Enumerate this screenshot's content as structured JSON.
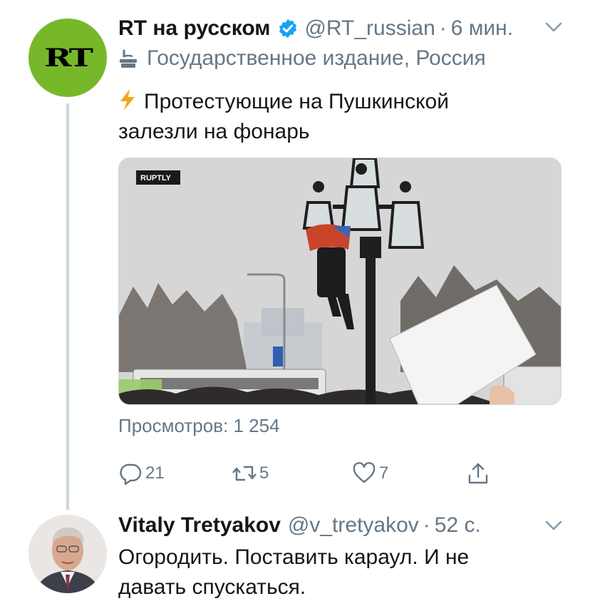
{
  "tweet1": {
    "avatar_text": "RT",
    "name": "RT на русском",
    "handle": "@RT_russian",
    "separator": "·",
    "time": "6 мин.",
    "affiliation": "Государственное издание, Россия",
    "text_line1": "Протестующие на Пушкинской",
    "text_line2": "залезли на фонарь",
    "media_watermark": "RUPTLY",
    "views": "Просмотров: 1 254",
    "actions": {
      "replies": "21",
      "retweets": "5",
      "likes": "7"
    },
    "icons": [
      "verified-badge-icon",
      "chevron-down-icon",
      "state-media-icon",
      "lightning-icon",
      "reply-icon",
      "retweet-icon",
      "like-icon",
      "share-icon"
    ]
  },
  "tweet2": {
    "name": "Vitaly Tretyakov",
    "handle": "@v_tretyakov",
    "separator": "·",
    "time": "52 с.",
    "text_line1": "Огородить. Поставить караул. И не",
    "text_line2": "давать спускаться."
  },
  "colors": {
    "accent": "#1da1f2",
    "secondary_text": "#657786",
    "rt_green": "#77b82a",
    "lightning": "#f4a623"
  }
}
